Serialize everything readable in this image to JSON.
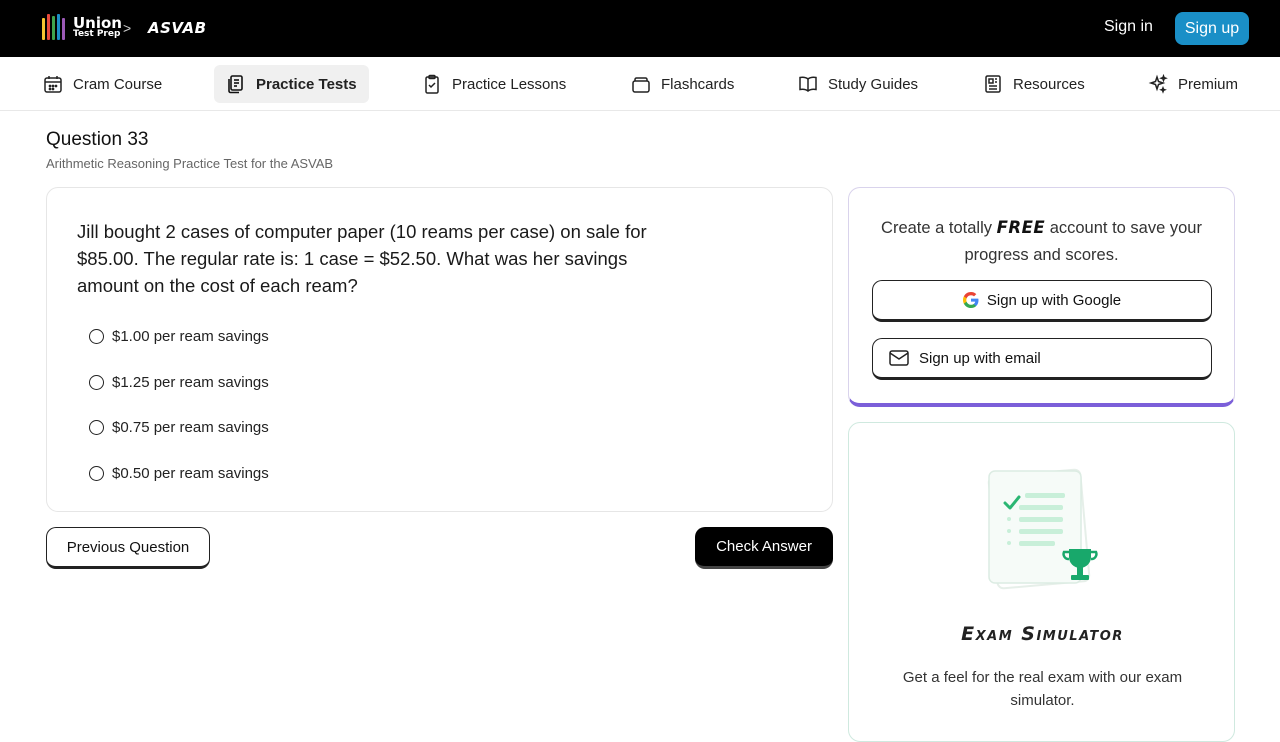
{
  "brand": {
    "logo_line1": "Union",
    "logo_line2": "Test Prep",
    "bar_colors": [
      "#f4c430",
      "#e94b3c",
      "#3fa34d",
      "#1a8fc7",
      "#9b59b6"
    ]
  },
  "header": {
    "breadcrumb_separator": ">",
    "breadcrumb_label": "ASVAB",
    "sign_in": "Sign in",
    "sign_up": "Sign up",
    "accent": "#1a8fc7"
  },
  "nav": {
    "items": [
      {
        "label": "Cram Course",
        "icon": "calendar-icon"
      },
      {
        "label": "Practice Tests",
        "icon": "documents-icon",
        "active": true
      },
      {
        "label": "Practice Lessons",
        "icon": "clipboard-check-icon"
      },
      {
        "label": "Flashcards",
        "icon": "cards-icon"
      },
      {
        "label": "Study Guides",
        "icon": "book-icon"
      },
      {
        "label": "Resources",
        "icon": "newspaper-icon"
      },
      {
        "label": "Premium",
        "icon": "sparkle-icon"
      }
    ]
  },
  "question": {
    "title": "Question 33",
    "subtitle": "Arithmetic Reasoning Practice Test for the ASVAB",
    "text": "Jill bought 2 cases of computer paper (10 reams per case) on sale for $85.00. The regular rate is: 1 case = $52.50. What was her savings amount on the cost of each ream?",
    "options": [
      "$1.00 per ream savings",
      "$1.25 per ream savings",
      "$0.75 per ream savings",
      "$0.50 per ream savings"
    ],
    "prev_button": "Previous Question",
    "check_button": "Check Answer"
  },
  "signup_card": {
    "text_before": "Create a totally ",
    "text_emph": "FREE",
    "text_after": " account to save your progress and scores.",
    "google_button": "Sign up with Google",
    "email_button": "Sign up with email",
    "accent": "#7b5fd9"
  },
  "exam_card": {
    "title": "Exam Simulator",
    "description": "Get a feel for the real exam with our exam simulator.",
    "accent": "#2bb673"
  }
}
